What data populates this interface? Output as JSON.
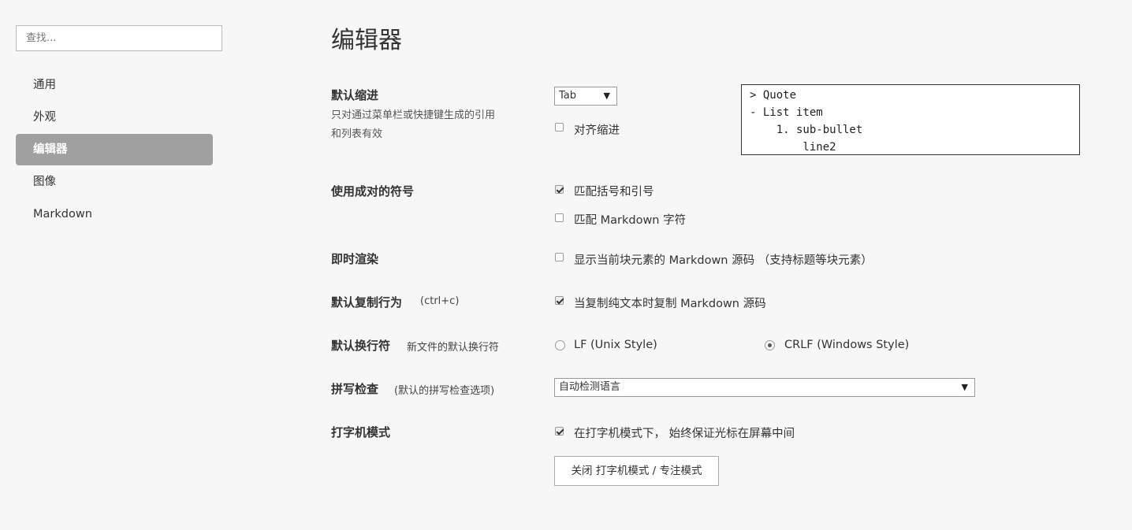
{
  "search": {
    "placeholder": "查找..."
  },
  "sidebar": {
    "items": [
      {
        "label": "通用"
      },
      {
        "label": "外观"
      },
      {
        "label": "编辑器",
        "active": true
      },
      {
        "label": "图像"
      },
      {
        "label": "Markdown"
      }
    ]
  },
  "page": {
    "title": "编辑器"
  },
  "indent": {
    "label": "默认缩进",
    "desc_line1": "只对通过菜单栏或快捷键生成的引用",
    "desc_line2": "和列表有效",
    "select_value": "Tab",
    "align_label": "对齐缩进",
    "align_checked": false,
    "preview": "> Quote\n- List item\n    1. sub-bullet\n        line2"
  },
  "pairs": {
    "label": "使用成对的符号",
    "brackets_label": "匹配括号和引号",
    "brackets_checked": true,
    "md_label": "匹配 Markdown 字符",
    "md_checked": false
  },
  "render": {
    "label": "即时渲染",
    "option_label": "显示当前块元素的 Markdown 源码 （支持标题等块元素）",
    "option_checked": false
  },
  "copy": {
    "label": "默认复制行为",
    "hint": "(ctrl+c)",
    "option_label": "当复制纯文本时复制 Markdown 源码",
    "option_checked": true
  },
  "linebreak": {
    "label": "默认换行符",
    "hint": "新文件的默认换行符",
    "lf_label": "LF (Unix Style)",
    "crlf_label": "CRLF (Windows Style)",
    "selected": "CRLF"
  },
  "spell": {
    "label": "拼写检查",
    "hint": "(默认的拼写检查选项)",
    "select_value": "自动检测语言"
  },
  "typewriter": {
    "label": "打字机模式",
    "option_label": "在打字机模式下， 始终保证光标在屏幕中间",
    "option_checked": true,
    "button_label": "关闭 打字机模式 / 专注模式"
  },
  "icons": {
    "dropdown": "▼"
  }
}
